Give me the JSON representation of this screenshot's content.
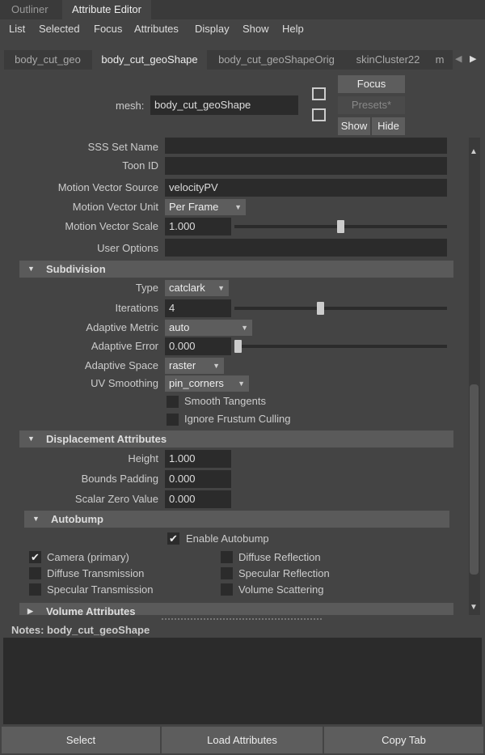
{
  "top_tabs": [
    "Outliner",
    "Attribute Editor"
  ],
  "menu": [
    "List",
    "Selected",
    "Focus",
    "Attributes",
    "Display",
    "Show",
    "Help"
  ],
  "node_tabs": [
    "body_cut_geo",
    "body_cut_geoShape",
    "body_cut_geoShapeOrig",
    "skinCluster22",
    "m"
  ],
  "header": {
    "mesh_label": "mesh:",
    "mesh_value": "body_cut_geoShape",
    "focus": "Focus",
    "presets": "Presets*",
    "show": "Show",
    "hide": "Hide"
  },
  "rows": {
    "sss_set_name": "SSS Set Name",
    "toon_id": "Toon ID",
    "mv_source": "Motion Vector Source",
    "mv_source_value": "velocityPV",
    "mv_unit": "Motion Vector Unit",
    "mv_unit_value": "Per Frame",
    "mv_scale": "Motion Vector Scale",
    "mv_scale_value": "1.000",
    "mv_scale_slider": 0.5,
    "user_options": "User Options"
  },
  "subdivision": {
    "title": "Subdivision",
    "type": "Type",
    "type_value": "catclark",
    "iterations": "Iterations",
    "iterations_value": "4",
    "iterations_slider": 0.4,
    "adaptive_metric": "Adaptive Metric",
    "adaptive_metric_value": "auto",
    "adaptive_error": "Adaptive Error",
    "adaptive_error_value": "0.000",
    "adaptive_error_slider": 0,
    "adaptive_space": "Adaptive Space",
    "adaptive_space_value": "raster",
    "uv_smoothing": "UV Smoothing",
    "uv_smoothing_value": "pin_corners",
    "smooth_tangents": "Smooth Tangents",
    "ignore_frustum": "Ignore Frustum Culling"
  },
  "displacement": {
    "title": "Displacement Attributes",
    "height": "Height",
    "height_value": "1.000",
    "bounds_padding": "Bounds Padding",
    "bounds_padding_value": "0.000",
    "scalar_zero": "Scalar Zero Value",
    "scalar_zero_value": "0.000"
  },
  "autobump": {
    "title": "Autobump",
    "enable": "Enable Autobump",
    "camera": "Camera (primary)",
    "diffuse_trans": "Diffuse Transmission",
    "specular_trans": "Specular Transmission",
    "diffuse_refl": "Diffuse Reflection",
    "specular_refl": "Specular Reflection",
    "volume_scat": "Volume Scattering"
  },
  "volume": {
    "title": "Volume Attributes"
  },
  "notes": {
    "label": "Notes:  body_cut_geoShape"
  },
  "bottom": {
    "select": "Select",
    "load": "Load Attributes",
    "copy": "Copy Tab"
  }
}
